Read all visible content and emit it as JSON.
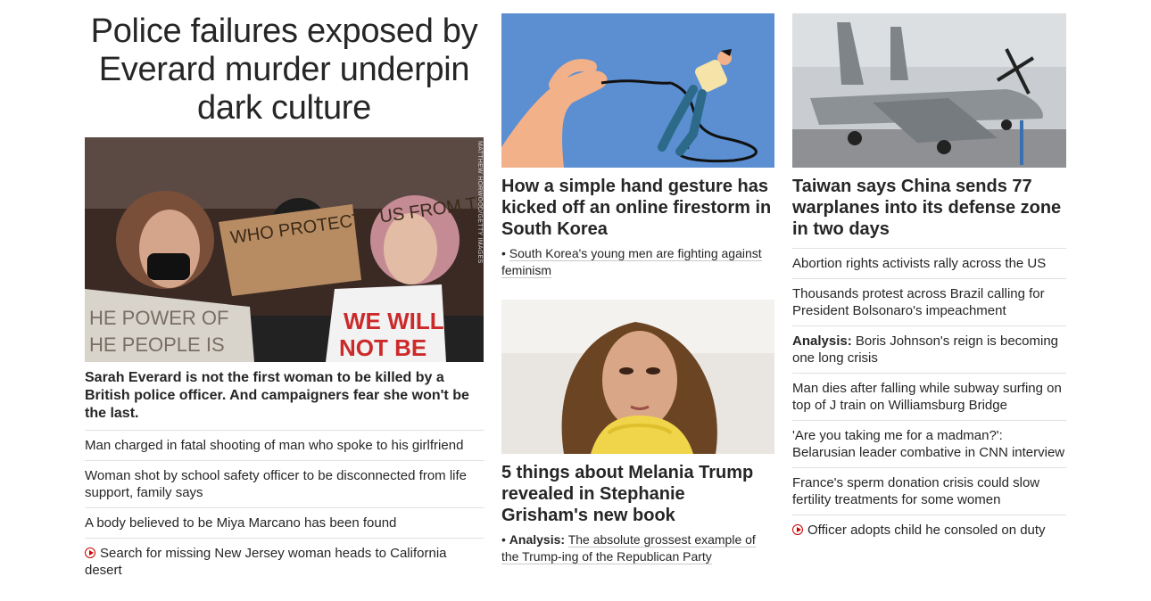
{
  "column1": {
    "headline": "Police failures exposed by Everard murder underpin dark culture",
    "image_credit": "MATTHEW HORWOOD/GETTY IMAGES",
    "image_sign_text": "WHO PROTECTS US FROM THE POLICE?",
    "lead": "Sarah Everard is not the first woman to be killed by a British police officer. And campaigners fear she won't be the last.",
    "links": [
      {
        "text": "Man charged in fatal shooting of man who spoke to his girlfriend"
      },
      {
        "text": "Woman shot by school safety officer to be disconnected from life support, family says"
      },
      {
        "text": "A body believed to be Miya Marcano has been found"
      },
      {
        "text": "Search for missing New Jersey woman heads to California desert",
        "video": true
      }
    ]
  },
  "column2": {
    "card1": {
      "title": "How a simple hand gesture has kicked off an online firestorm in South Korea",
      "sub_prefix": "• ",
      "sub_link": "South Korea's young men are fighting against feminism"
    },
    "card2": {
      "title": "5 things about Melania Trump revealed in Stephanie Grisham's new book",
      "sub_prefix": "• ",
      "sub_bold": "Analysis:",
      "sub_link": "The absolute grossest example of the Trump-ing of the Republican Party"
    }
  },
  "column3": {
    "title": "Taiwan says China sends 77 warplanes into its defense zone in two days",
    "links": [
      {
        "text": "Abortion rights activists rally across the US"
      },
      {
        "text": "Thousands protest across Brazil calling for President Bolsonaro's impeachment"
      },
      {
        "prefix": "Analysis:",
        "text": " Boris Johnson's reign is becoming one long crisis"
      },
      {
        "text": "Man dies after falling while subway surfing on top of J train on Williamsburg Bridge"
      },
      {
        "text": "'Are you taking me for a madman?': Belarusian leader combative in CNN interview"
      },
      {
        "text": "France's sperm donation crisis could slow fertility treatments for some women"
      },
      {
        "text": "Officer adopts child he consoled on duty",
        "video": true
      }
    ]
  },
  "colors": {
    "text": "#262626",
    "divider": "#e0e0e0",
    "video_icon": "#cc0000",
    "illustration_bg": "#5b8fd1"
  }
}
